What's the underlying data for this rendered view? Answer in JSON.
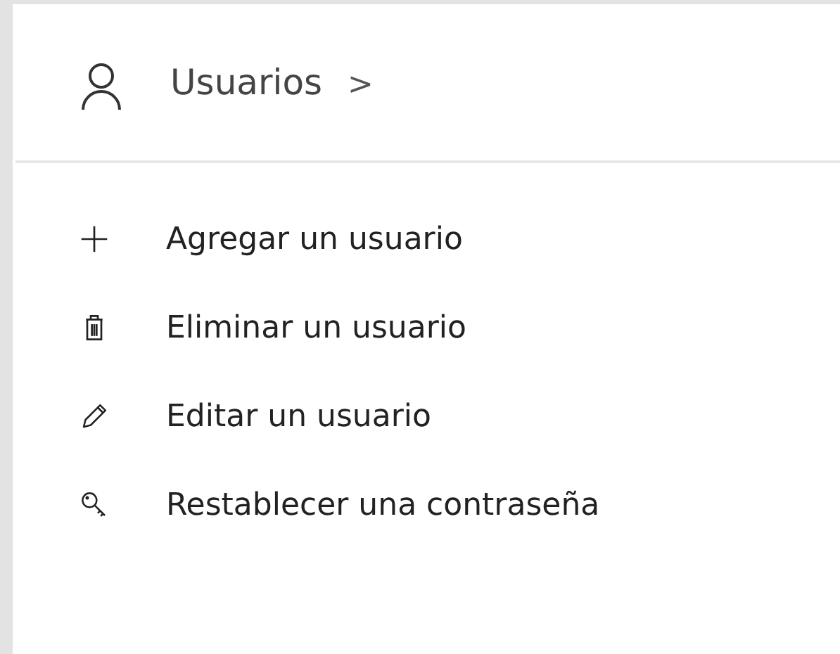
{
  "header": {
    "title": "Usuarios",
    "chevron": ">"
  },
  "actions": [
    {
      "kind": "add",
      "label": "Agregar un usuario"
    },
    {
      "kind": "delete",
      "label": "Eliminar un usuario"
    },
    {
      "kind": "edit",
      "label": "Editar un usuario"
    },
    {
      "kind": "key",
      "label": "Restablecer una contraseña"
    }
  ]
}
